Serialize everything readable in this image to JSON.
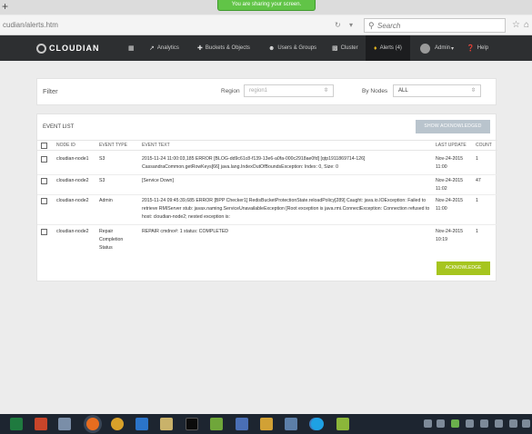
{
  "browser": {
    "share_notice": "You are sharing your screen.",
    "url": "cudian/alerts.htm",
    "search_placeholder": "Search",
    "new_tab_glyph": "+"
  },
  "app": {
    "brand": "CLOUDIAN",
    "nav": [
      {
        "label": "Analytics",
        "icon": "chart-icon"
      },
      {
        "label": "Buckets & Objects",
        "icon": "buckets-icon"
      },
      {
        "label": "Users & Groups",
        "icon": "users-icon"
      },
      {
        "label": "Cluster",
        "icon": "cluster-icon"
      },
      {
        "label": "Alerts (4)",
        "icon": "bell-icon"
      },
      {
        "label": "Admin",
        "icon": "avatar"
      },
      {
        "label": "Help",
        "icon": "help-icon"
      }
    ]
  },
  "filter": {
    "title": "Filter",
    "region_label": "Region",
    "region_value": "region1",
    "nodes_label": "By Nodes",
    "nodes_value": "ALL"
  },
  "events": {
    "title": "EVENT LIST",
    "show_ack_label": "SHOW ACKNOWLEDGED",
    "acknowledge_label": "ACKNOWLEDGE",
    "columns": [
      "NODE ID",
      "EVENT TYPE",
      "EVENT TEXT",
      "LAST UPDATE",
      "COUNT"
    ],
    "rows": [
      {
        "node": "cloudian-node1",
        "type": "S3",
        "text": "2015-11-24 11:00:03,185 ERROR [BLOG-dd9c61c8-f139-13e6-a0fa-000c2918ae0fd] [qtp1911869714-126] CassandraCommon.getRowKeys[66] java.lang.IndexOutOfBoundsException: Index: 0, Size: 0",
        "update": "Nov-24-2015 11:00",
        "count": "1"
      },
      {
        "node": "cloudian-node2",
        "type": "S3",
        "text": "[Service Down]",
        "update": "Nov-24-2015 11:02",
        "count": "47"
      },
      {
        "node": "cloudian-node2",
        "type": "Admin",
        "text": "2015-11-24 09:45:39,685 ERROR [BPP Checker1] RedisBucketProtectionState.reloadPolicy[289] Caught: java.io.IOException: Failed to retrieve RMIServer stub: javax.naming.ServiceUnavailableException [Root exception is java.rmi.ConnectException: Connection refused to host: cloudian-node2; nested exception is:",
        "update": "Nov-24-2015 11:00",
        "count": "1"
      },
      {
        "node": "cloudian-node2",
        "type": "Repair Completion Status",
        "text": "REPAIR cmdno#: 1 status: COMPLETED",
        "update": "Nov-24-2015 10:19",
        "count": "1"
      }
    ]
  },
  "taskbar": {
    "apps": [
      "excel-icon",
      "powerpoint-icon",
      "photos-icon",
      "firefox-icon",
      "chrome-icon",
      "edge-icon",
      "explorer-icon",
      "terminal-icon",
      "notepad-icon",
      "network-icon",
      "tools-icon",
      "remote-desktop-icon",
      "people-icon",
      "skype-icon",
      "vmware-icon"
    ]
  }
}
